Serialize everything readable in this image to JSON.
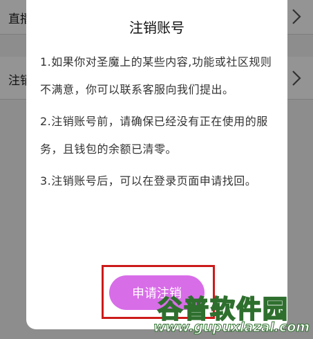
{
  "background": {
    "rows": [
      {
        "label": "直播",
        "chevron": "chevron-right-icon"
      },
      {
        "label": "注销",
        "chevron": "chevron-right-icon"
      }
    ]
  },
  "dialog": {
    "title": "注销账号",
    "paragraphs": [
      "1.如果你对圣魔上的某些内容,功能或社区规则不满意，你可以联系客服向我们提出。",
      "2.注销账号前，请确保已经没有正在使用的服务，且钱包的余额已清零。",
      "3.注销账号后，可以在登录页面申请找回。"
    ],
    "button_label": "申请注销"
  },
  "watermark": {
    "name": "谷普软件园",
    "url": "www.gupuxlazal.com"
  },
  "colors": {
    "accent": "#d86de8",
    "highlight": "#cc1a1a",
    "watermark_green": "#2e6f2e"
  }
}
